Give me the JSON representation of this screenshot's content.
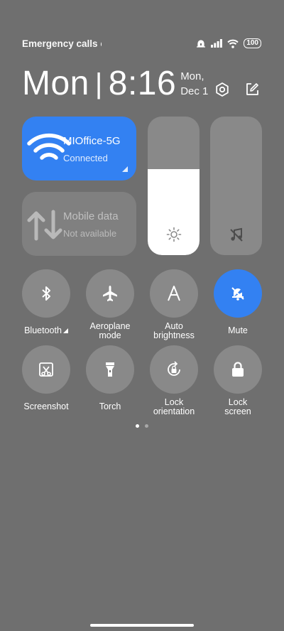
{
  "status_bar": {
    "carrier_text": "Emergency calls o",
    "battery": "100",
    "icons": [
      "alarm-icon",
      "signal-icon",
      "wifi-icon",
      "battery-icon"
    ]
  },
  "header": {
    "day": "Mon",
    "separator": "|",
    "time": "8:16",
    "date_line1": "Mon,",
    "date_line2": "Dec 1",
    "icons": [
      "settings-icon",
      "edit-icon"
    ]
  },
  "tiles": {
    "wifi": {
      "title": "MIOffice-5G",
      "subtitle": "Connected",
      "icon": "wifi-icon",
      "active": true
    },
    "mobile": {
      "title": "Mobile data",
      "subtitle": "Not available",
      "icon": "mobile-data-icon",
      "active": false
    }
  },
  "sliders": {
    "brightness": {
      "icon": "brightness-icon",
      "level": 0.62
    },
    "volume": {
      "icon": "music-mute-icon",
      "level": 0
    }
  },
  "toggles": [
    {
      "label": "Bluetooth",
      "icon": "bluetooth-icon",
      "active": false
    },
    {
      "label": "Aeroplane\nmode",
      "icon": "airplane-icon",
      "active": false
    },
    {
      "label": "Auto\nbrightness",
      "icon": "auto-brightness-icon",
      "active": false
    },
    {
      "label": "Mute",
      "icon": "mute-icon",
      "active": true
    },
    {
      "label": "Screenshot",
      "icon": "screenshot-icon",
      "active": false
    },
    {
      "label": "Torch",
      "icon": "torch-icon",
      "active": false
    },
    {
      "label": "Lock\norientation",
      "icon": "lock-orientation-icon",
      "active": false
    },
    {
      "label": "Lock\nscreen",
      "icon": "lock-icon",
      "active": false
    }
  ],
  "pager": {
    "pages": 2,
    "current": 1
  },
  "colors": {
    "background": "#6f6f6f",
    "accent": "#3381f2"
  }
}
